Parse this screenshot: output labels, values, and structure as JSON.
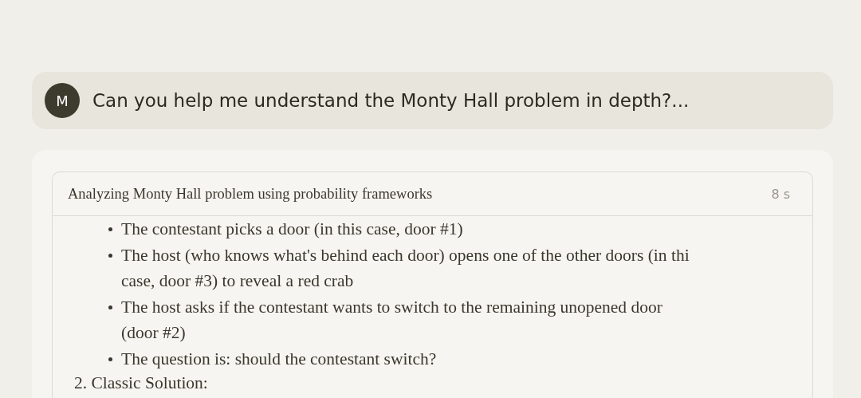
{
  "user_message": {
    "avatar": "M",
    "text": "Can you help me understand the Monty Hall problem in depth?..."
  },
  "thinking": {
    "title": "Analyzing Monty Hall problem using probability frameworks",
    "duration": "8 s",
    "bullets": [
      {
        "lines": [
          "The contestant picks a door (in this case, door #1)"
        ]
      },
      {
        "lines": [
          "The host (who knows what's behind each door) opens one of the other doors (in thi",
          "case, door #3) to reveal a red crab"
        ]
      },
      {
        "lines": [
          "The host asks if the contestant wants to switch to the remaining unopened door",
          "(door #2)"
        ]
      },
      {
        "lines": [
          "The question is: should the contestant switch?"
        ]
      }
    ],
    "next_heading": "2. Classic Solution:"
  }
}
